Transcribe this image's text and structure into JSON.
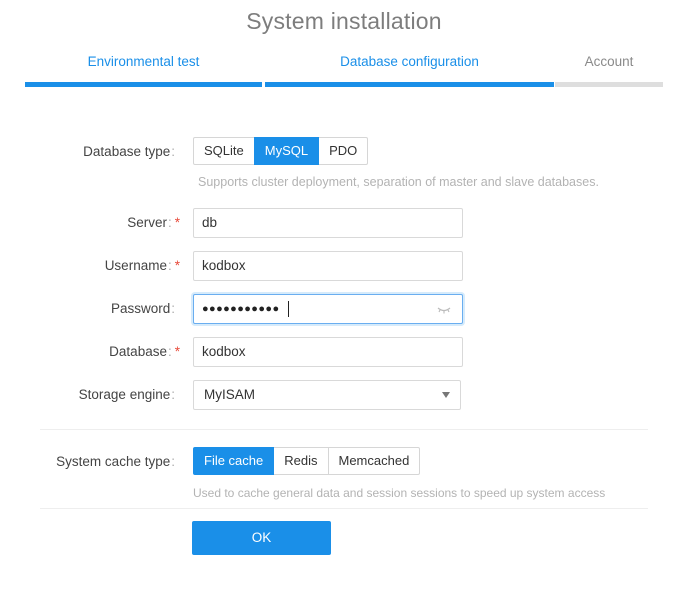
{
  "title": "System installation",
  "steps": [
    {
      "label": "Environmental test",
      "state": "done"
    },
    {
      "label": "Database configuration",
      "state": "done"
    },
    {
      "label": "Account",
      "state": "todo"
    }
  ],
  "form": {
    "db_type": {
      "label": "Database type",
      "options": [
        "SQLite",
        "MySQL",
        "PDO"
      ],
      "selected": "MySQL",
      "hint": "Supports cluster deployment, separation of master and slave databases."
    },
    "server": {
      "label": "Server",
      "value": "db",
      "required": true
    },
    "username": {
      "label": "Username",
      "value": "kodbox",
      "required": true
    },
    "password": {
      "label": "Password",
      "masked": "●●●●●●●●●●●",
      "required": false
    },
    "database": {
      "label": "Database",
      "value": "kodbox",
      "required": true
    },
    "engine": {
      "label": "Storage engine",
      "value": "MyISAM"
    },
    "cache_type": {
      "label": "System cache type",
      "options": [
        "File cache",
        "Redis",
        "Memcached"
      ],
      "selected": "File cache",
      "hint": "Used to cache general data and session sessions to speed up system access"
    },
    "colon": ":",
    "required_mark": "*",
    "ok_label": "OK"
  },
  "colors": {
    "accent": "#1a8fe8",
    "required": "#e84a3a"
  },
  "icons": {
    "password_toggle": "eye-closed-icon",
    "select_arrow": "caret-down-icon"
  }
}
